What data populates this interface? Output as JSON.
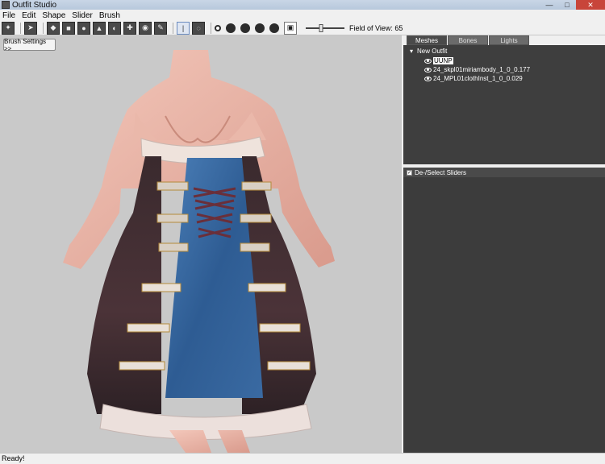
{
  "window": {
    "title": "Outfit Studio"
  },
  "menu": [
    "File",
    "Edit",
    "Shape",
    "Slider",
    "Brush"
  ],
  "toolbar": {
    "fov_label": "Field of View: 65",
    "fov_value": 65
  },
  "viewport": {
    "brush_settings_label": "Brush Settings >>"
  },
  "tabs": [
    "Meshes",
    "Bones",
    "Lights"
  ],
  "meshes": {
    "root": "New Outfit",
    "items": [
      {
        "name": "UUNP",
        "selected": true
      },
      {
        "name": "24_skpl01miriambody_1_0_0.177",
        "selected": false
      },
      {
        "name": "24_MPL01clothInst_1_0_0.029",
        "selected": false
      }
    ]
  },
  "sliders": {
    "header": "De-/Select Sliders"
  },
  "status": {
    "text": "Ready!"
  }
}
